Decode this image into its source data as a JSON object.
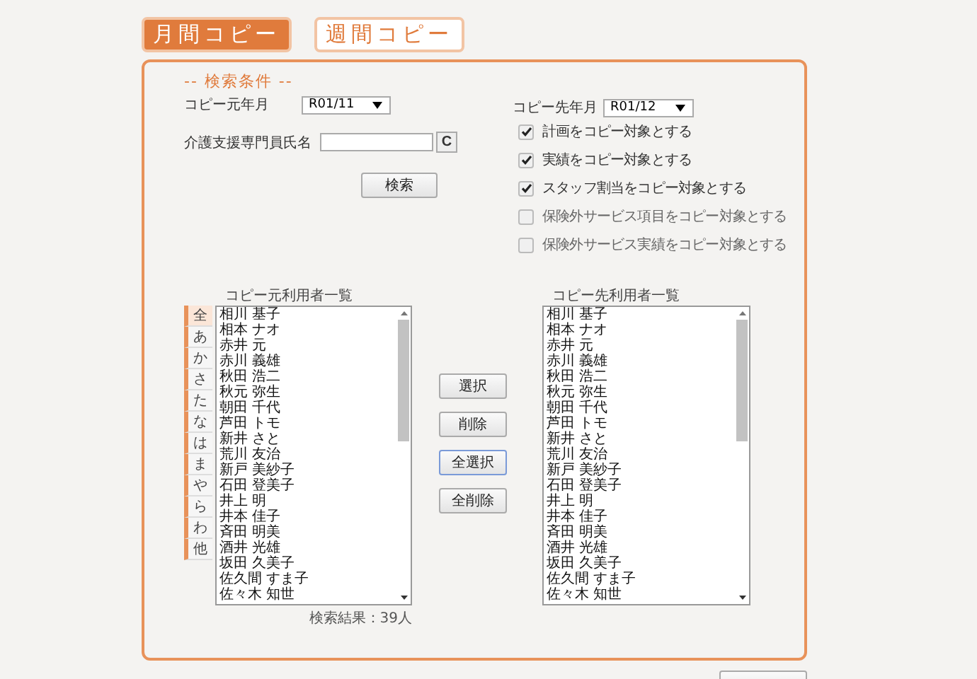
{
  "mode_tabs": [
    {
      "label": "月間コピー",
      "selected": true
    },
    {
      "label": "週間コピー",
      "selected": false
    }
  ],
  "search_conditions": {
    "legend": "-- 検索条件 --",
    "source_month": {
      "label": "コピー元年月",
      "value": "R01/11"
    },
    "manager_name": {
      "label": "介護支援専門員氏名"
    },
    "clear_button": "C",
    "search_button": "検索",
    "target_month": {
      "label": "コピー先年月",
      "value": "R01/12"
    },
    "options": [
      {
        "label": "計画をコピー対象とする",
        "checked": true
      },
      {
        "label": "実績をコピー対象とする",
        "checked": true
      },
      {
        "label": "スタッフ割当をコピー対象とする",
        "checked": true
      },
      {
        "label": "保険外サービス項目をコピー対象とする",
        "checked": false
      },
      {
        "label": "保険外サービス実績をコピー対象とする",
        "checked": false
      }
    ]
  },
  "source_list": {
    "title": "コピー元利用者一覧",
    "kana_tabs": [
      {
        "label": "全",
        "selected": true
      },
      {
        "label": "あ",
        "selected": false
      },
      {
        "label": "か",
        "selected": false
      },
      {
        "label": "さ",
        "selected": false
      },
      {
        "label": "た",
        "selected": false
      },
      {
        "label": "な",
        "selected": false
      },
      {
        "label": "は",
        "selected": false
      },
      {
        "label": "ま",
        "selected": false
      },
      {
        "label": "や",
        "selected": false
      },
      {
        "label": "ら",
        "selected": false
      },
      {
        "label": "わ",
        "selected": false
      },
      {
        "label": "他",
        "selected": false
      }
    ],
    "users": [
      "相川 基子",
      "相本 ナオ",
      "赤井 元",
      "赤川 義雄",
      "秋田 浩二",
      "秋元 弥生",
      "朝田 千代",
      "芦田 トモ",
      "新井 さと",
      "荒川 友治",
      "新戸 美紗子",
      "石田 登美子",
      "井上 明",
      "井本 佳子",
      "斉田 明美",
      "酒井 光雄",
      "坂田 久美子",
      "佐久間 すま子",
      "佐々木 知世"
    ],
    "result": "検索結果：39人"
  },
  "transfer_buttons": [
    {
      "label": "選択",
      "focused": false
    },
    {
      "label": "削除",
      "focused": false
    },
    {
      "label": "全選択",
      "focused": true
    },
    {
      "label": "全削除",
      "focused": false
    }
  ],
  "target_list": {
    "title": "コピー先利用者一覧",
    "users": [
      "相川 基子",
      "相本 ナオ",
      "赤井 元",
      "赤川 義雄",
      "秋田 浩二",
      "秋元 弥生",
      "朝田 千代",
      "芦田 トモ",
      "新井 さと",
      "荒川 友治",
      "新戸 美紗子",
      "石田 登美子",
      "井上 明",
      "井本 佳子",
      "斉田 明美",
      "酒井 光雄",
      "坂田 久美子",
      "佐久間 すま子",
      "佐々木 知世"
    ]
  }
}
